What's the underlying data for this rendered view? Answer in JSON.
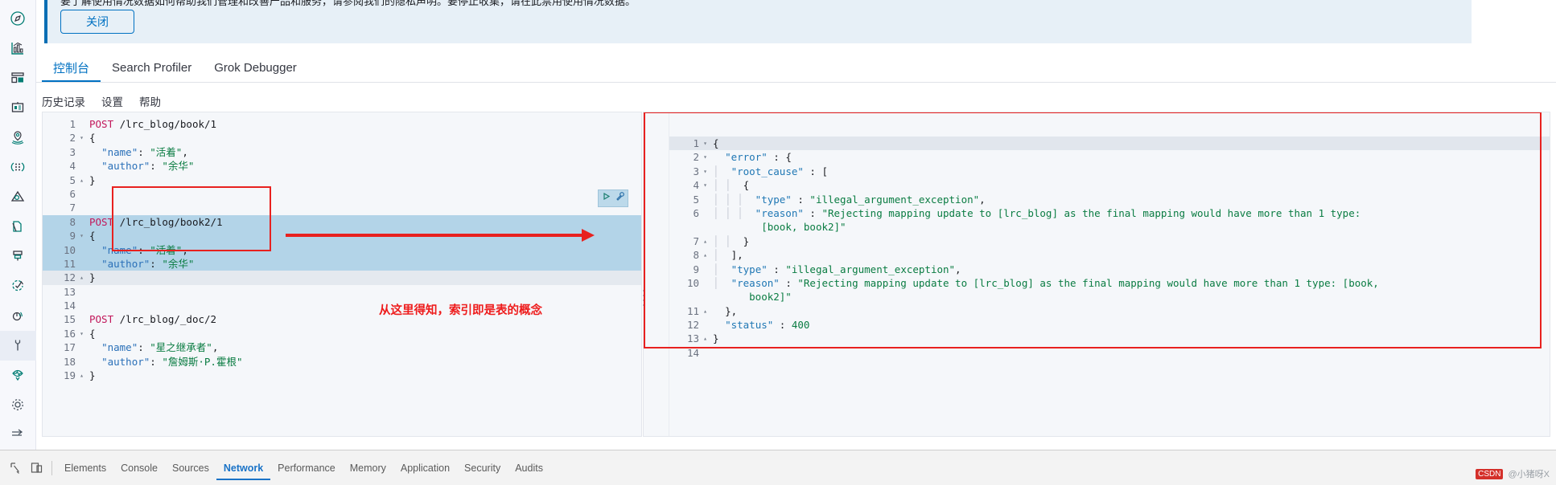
{
  "banner": {
    "text": "要了解使用情况数据如何帮助我们管理和改善产品和服务，请参阅我们的隐私声明。要停止收集，请在此禁用使用情况数据。",
    "link_1": "隐私声明",
    "link_2": "请在此禁用使用情况数据",
    "close_label": "关闭",
    "accent": "#0a6fb4"
  },
  "tabs": [
    {
      "label": "控制台",
      "active": true
    },
    {
      "label": "Search Profiler",
      "active": false
    },
    {
      "label": "Grok Debugger",
      "active": false
    }
  ],
  "submenu": [
    {
      "label": "历史记录"
    },
    {
      "label": "设置"
    },
    {
      "label": "帮助"
    }
  ],
  "sidebar": {
    "items": [
      {
        "name": "discover-icon",
        "label": "Discover"
      },
      {
        "name": "visualize-icon",
        "label": "Visualize"
      },
      {
        "name": "dashboard-icon",
        "label": "Dashboard"
      },
      {
        "name": "canvas-icon",
        "label": "Canvas"
      },
      {
        "name": "maps-icon",
        "label": "Maps"
      },
      {
        "name": "machine-learning-icon",
        "label": "Machine Learning"
      },
      {
        "name": "infrastructure-icon",
        "label": "Infrastructure"
      },
      {
        "name": "logs-icon",
        "label": "Logs"
      },
      {
        "name": "apm-icon",
        "label": "APM"
      },
      {
        "name": "uptime-icon",
        "label": "Uptime"
      },
      {
        "name": "siem-icon",
        "label": "SIEM"
      },
      {
        "name": "dev-tools-icon",
        "label": "Dev Tools",
        "active": true
      },
      {
        "name": "monitoring-icon",
        "label": "Monitoring"
      },
      {
        "name": "management-icon",
        "label": "Management"
      },
      {
        "name": "collapse-icon",
        "label": "Collapse"
      }
    ]
  },
  "request_editor": {
    "name": "console-request-editor",
    "lines": [
      {
        "n": "1",
        "fold": "",
        "indent": 0,
        "tokens": [
          {
            "t": "method",
            "v": "POST"
          },
          {
            "t": "sp",
            "v": " "
          },
          {
            "t": "url",
            "v": "/lrc_blog/book/1"
          }
        ]
      },
      {
        "n": "2",
        "fold": "▾",
        "indent": 0,
        "tokens": [
          {
            "t": "punc",
            "v": "{"
          }
        ]
      },
      {
        "n": "3",
        "fold": "",
        "indent": 0,
        "tokens": [
          {
            "t": "sp",
            "v": "  "
          },
          {
            "t": "key",
            "v": "\"name\""
          },
          {
            "t": "punc",
            "v": ": "
          },
          {
            "t": "str",
            "v": "\"活着\""
          },
          {
            "t": "punc",
            "v": ","
          }
        ]
      },
      {
        "n": "4",
        "fold": "",
        "indent": 0,
        "tokens": [
          {
            "t": "sp",
            "v": "  "
          },
          {
            "t": "key",
            "v": "\"author\""
          },
          {
            "t": "punc",
            "v": ": "
          },
          {
            "t": "str",
            "v": "\"余华\""
          }
        ]
      },
      {
        "n": "5",
        "fold": "▴",
        "indent": 0,
        "tokens": [
          {
            "t": "punc",
            "v": "}"
          }
        ]
      },
      {
        "n": "6",
        "fold": "",
        "indent": 0,
        "tokens": []
      },
      {
        "n": "7",
        "fold": "",
        "indent": 0,
        "tokens": []
      },
      {
        "n": "8",
        "fold": "",
        "indent": 0,
        "hl": "sel",
        "tokens": [
          {
            "t": "method",
            "v": "POST"
          },
          {
            "t": "sp",
            "v": " "
          },
          {
            "t": "url",
            "v": "/lrc_blog/book2/1"
          }
        ]
      },
      {
        "n": "9",
        "fold": "▾",
        "indent": 0,
        "hl": "sel",
        "tokens": [
          {
            "t": "punc",
            "v": "{"
          }
        ]
      },
      {
        "n": "10",
        "fold": "",
        "indent": 0,
        "hl": "sel",
        "tokens": [
          {
            "t": "sp",
            "v": "  "
          },
          {
            "t": "key",
            "v": "\"name\""
          },
          {
            "t": "punc",
            "v": ": "
          },
          {
            "t": "str",
            "v": "\"活着\""
          },
          {
            "t": "punc",
            "v": ","
          }
        ]
      },
      {
        "n": "11",
        "fold": "",
        "indent": 0,
        "hl": "sel",
        "tokens": [
          {
            "t": "sp",
            "v": "  "
          },
          {
            "t": "key",
            "v": "\"author\""
          },
          {
            "t": "punc",
            "v": ": "
          },
          {
            "t": "str",
            "v": "\"余华\""
          }
        ]
      },
      {
        "n": "12",
        "fold": "▴",
        "indent": 0,
        "hl": "sel2",
        "tokens": [
          {
            "t": "punc",
            "v": "}"
          }
        ]
      },
      {
        "n": "13",
        "fold": "",
        "indent": 0,
        "tokens": []
      },
      {
        "n": "14",
        "fold": "",
        "indent": 0,
        "tokens": []
      },
      {
        "n": "15",
        "fold": "",
        "indent": 0,
        "tokens": [
          {
            "t": "method",
            "v": "POST"
          },
          {
            "t": "sp",
            "v": " "
          },
          {
            "t": "url",
            "v": "/lrc_blog/_doc/2"
          }
        ]
      },
      {
        "n": "16",
        "fold": "▾",
        "indent": 0,
        "tokens": [
          {
            "t": "punc",
            "v": "{"
          }
        ]
      },
      {
        "n": "17",
        "fold": "",
        "indent": 0,
        "tokens": [
          {
            "t": "sp",
            "v": "  "
          },
          {
            "t": "key",
            "v": "\"name\""
          },
          {
            "t": "punc",
            "v": ": "
          },
          {
            "t": "str",
            "v": "\"星之继承者\""
          },
          {
            "t": "punc",
            "v": ","
          }
        ]
      },
      {
        "n": "18",
        "fold": "",
        "indent": 0,
        "tokens": [
          {
            "t": "sp",
            "v": "  "
          },
          {
            "t": "key",
            "v": "\"author\""
          },
          {
            "t": "punc",
            "v": ": "
          },
          {
            "t": "str",
            "v": "\"詹姆斯·P.霍根\""
          }
        ]
      },
      {
        "n": "19",
        "fold": "▴",
        "indent": 0,
        "tokens": [
          {
            "t": "punc",
            "v": "}"
          }
        ]
      }
    ]
  },
  "response_editor": {
    "name": "console-response-editor",
    "status_code": 400,
    "lines": [
      {
        "n": "1",
        "fold": "▾",
        "hl": "cur",
        "tokens": [
          {
            "t": "punc",
            "v": "{"
          }
        ]
      },
      {
        "n": "2",
        "fold": "▾",
        "tokens": [
          {
            "t": "sp",
            "v": "  "
          },
          {
            "t": "rkey",
            "v": "\"error\""
          },
          {
            "t": "punc",
            "v": " : {"
          }
        ]
      },
      {
        "n": "3",
        "fold": "▾",
        "tokens": [
          {
            "t": "guide",
            "v": "│ "
          },
          {
            "t": "rkey",
            "v": " \"root_cause\""
          },
          {
            "t": "punc",
            "v": " : ["
          }
        ]
      },
      {
        "n": "4",
        "fold": "▾",
        "tokens": [
          {
            "t": "guide",
            "v": "│ │ "
          },
          {
            "t": "punc",
            "v": " {"
          }
        ]
      },
      {
        "n": "5",
        "fold": "",
        "tokens": [
          {
            "t": "guide",
            "v": "│ │ │ "
          },
          {
            "t": "rkey",
            "v": " \"type\""
          },
          {
            "t": "punc",
            "v": " : "
          },
          {
            "t": "rstr",
            "v": "\"illegal_argument_exception\""
          },
          {
            "t": "punc",
            "v": ","
          }
        ]
      },
      {
        "n": "6",
        "fold": "",
        "tokens": [
          {
            "t": "guide",
            "v": "│ │ │ "
          },
          {
            "t": "rkey",
            "v": " \"reason\""
          },
          {
            "t": "punc",
            "v": " : "
          },
          {
            "t": "rstr",
            "v": "\"Rejecting mapping update to [lrc_blog] as the final mapping would have more than 1 type:"
          }
        ]
      },
      {
        "n": "",
        "fold": "",
        "tokens": [
          {
            "t": "sp",
            "v": "        "
          },
          {
            "t": "rstr",
            "v": "[book, book2]\""
          }
        ]
      },
      {
        "n": "7",
        "fold": "▴",
        "tokens": [
          {
            "t": "guide",
            "v": "│ │ "
          },
          {
            "t": "punc",
            "v": " }"
          }
        ]
      },
      {
        "n": "8",
        "fold": "▴",
        "tokens": [
          {
            "t": "guide",
            "v": "│ "
          },
          {
            "t": "punc",
            "v": " ],"
          }
        ]
      },
      {
        "n": "9",
        "fold": "",
        "tokens": [
          {
            "t": "guide",
            "v": "│ "
          },
          {
            "t": "rkey",
            "v": " \"type\""
          },
          {
            "t": "punc",
            "v": " : "
          },
          {
            "t": "rstr",
            "v": "\"illegal_argument_exception\""
          },
          {
            "t": "punc",
            "v": ","
          }
        ]
      },
      {
        "n": "10",
        "fold": "",
        "tokens": [
          {
            "t": "guide",
            "v": "│ "
          },
          {
            "t": "rkey",
            "v": " \"reason\""
          },
          {
            "t": "punc",
            "v": " : "
          },
          {
            "t": "rstr",
            "v": "\"Rejecting mapping update to [lrc_blog] as the final mapping would have more than 1 type: [book,"
          }
        ]
      },
      {
        "n": "",
        "fold": "",
        "tokens": [
          {
            "t": "sp",
            "v": "      "
          },
          {
            "t": "rstr",
            "v": "book2]\""
          }
        ]
      },
      {
        "n": "11",
        "fold": "▴",
        "tokens": [
          {
            "t": "sp",
            "v": "  "
          },
          {
            "t": "punc",
            "v": "},"
          }
        ]
      },
      {
        "n": "12",
        "fold": "",
        "tokens": [
          {
            "t": "sp",
            "v": "  "
          },
          {
            "t": "rkey",
            "v": "\"status\""
          },
          {
            "t": "punc",
            "v": " : "
          },
          {
            "t": "num",
            "v": "400"
          }
        ]
      },
      {
        "n": "13",
        "fold": "▴",
        "tokens": [
          {
            "t": "punc",
            "v": "}"
          }
        ]
      },
      {
        "n": "14",
        "fold": "",
        "tokens": []
      }
    ]
  },
  "annotations": {
    "note_text": "从这里得知，索引即是表的概念",
    "note_color": "#ee1c1c",
    "box_color": "#e8211f"
  },
  "editor_actions": {
    "play_icon": "play-triangle-icon",
    "wrench_icon": "wrench-icon"
  },
  "devtools": {
    "icons": [
      {
        "name": "inspect-element-icon"
      },
      {
        "name": "toggle-device-toolbar-icon"
      }
    ],
    "tabs": [
      {
        "label": "Elements",
        "active": false
      },
      {
        "label": "Console",
        "active": false
      },
      {
        "label": "Sources",
        "active": false
      },
      {
        "label": "Network",
        "active": true
      },
      {
        "label": "Performance",
        "active": false
      },
      {
        "label": "Memory",
        "active": false
      },
      {
        "label": "Application",
        "active": false
      },
      {
        "label": "Security",
        "active": false
      },
      {
        "label": "Audits",
        "active": false
      }
    ]
  },
  "watermark": {
    "badge": "CSDN",
    "text": "@小猪呀X"
  }
}
